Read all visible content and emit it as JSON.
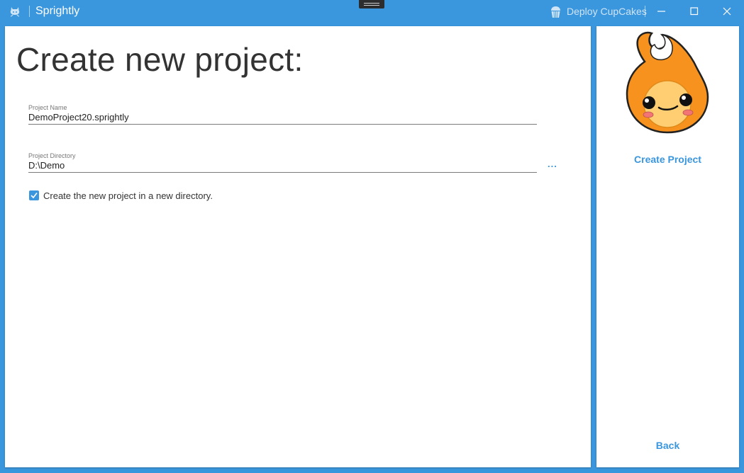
{
  "window": {
    "title": "Sprightly",
    "deploy_label": "Deploy CupCakes",
    "accent_color": "#3a96dd",
    "icons": [
      "github-icon",
      "cupcake-icon",
      "minimize-icon",
      "maximize-icon",
      "close-icon"
    ]
  },
  "main": {
    "heading": "Create new project:",
    "project_name": {
      "label": "Project Name",
      "value": "DemoProject20.sprightly"
    },
    "project_directory": {
      "label": "Project Directory",
      "value": "D:\\Demo",
      "browse_label": "..."
    },
    "new_directory_checkbox": {
      "label": "Create the new project in a new directory.",
      "checked": true
    }
  },
  "side": {
    "create_label": "Create Project",
    "back_label": "Back"
  }
}
